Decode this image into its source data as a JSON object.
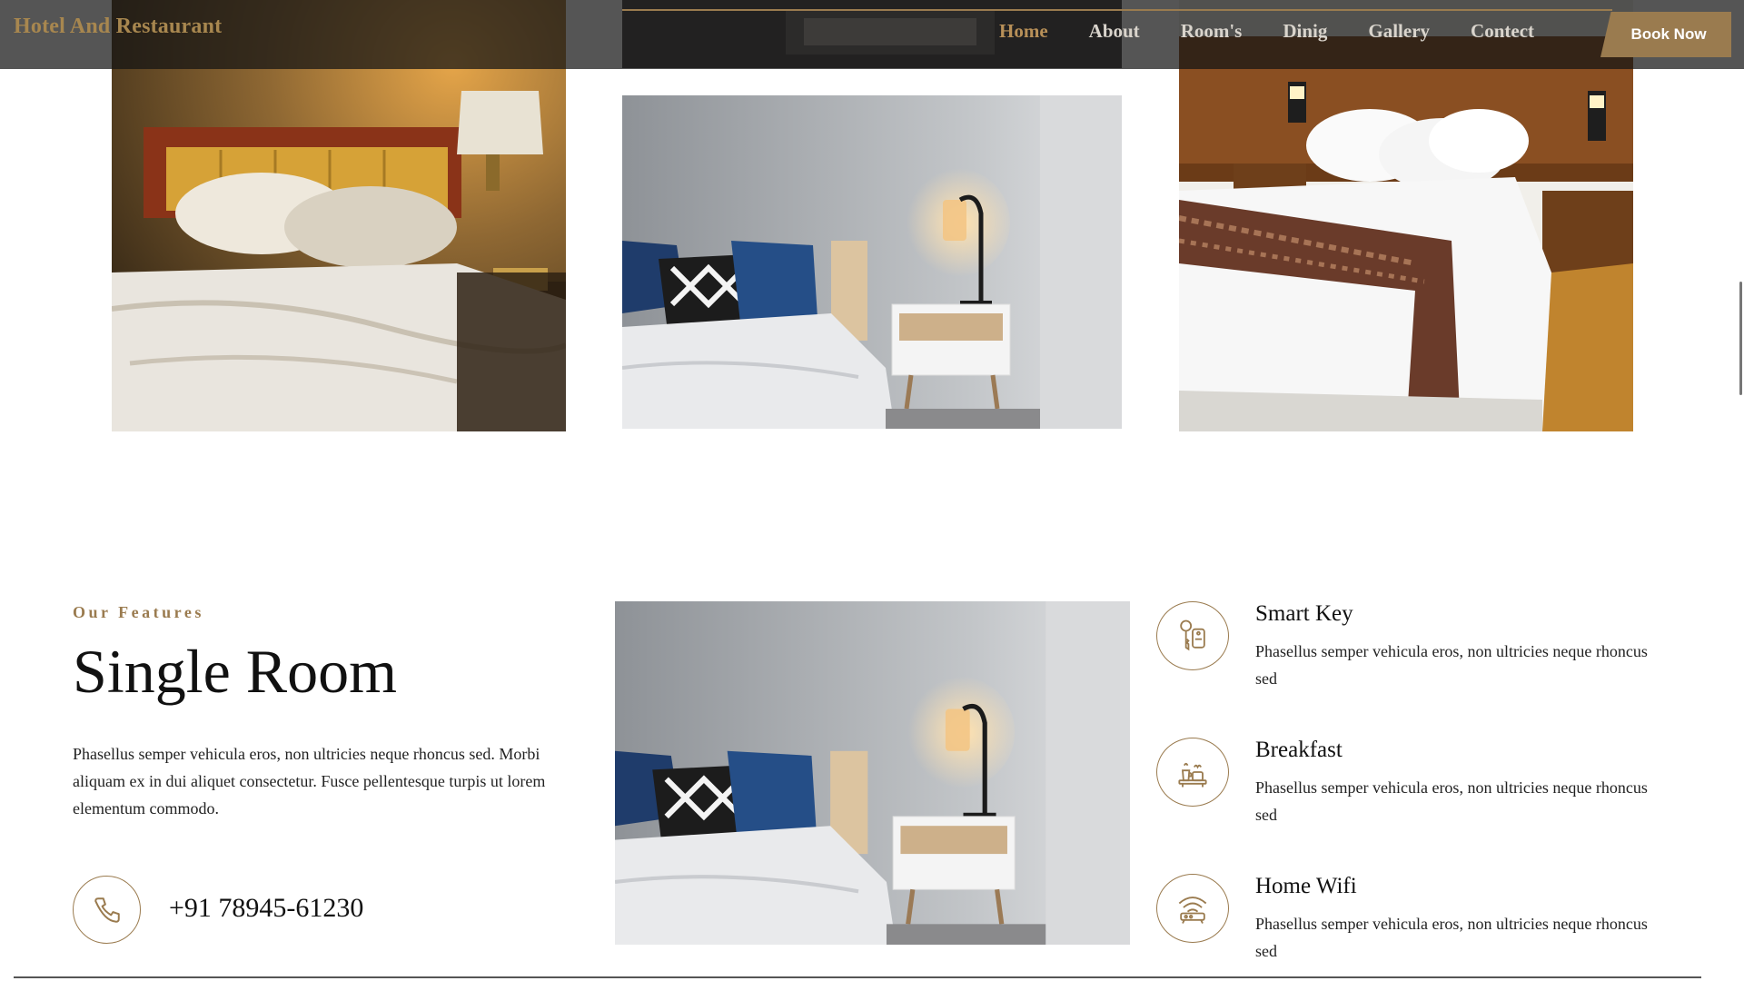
{
  "nav": {
    "brand": "Hotel And Restaurant",
    "links": [
      "Home",
      "About",
      "Room's",
      "Dinig",
      "Gallery",
      "Contect"
    ],
    "active": "Home",
    "book_label": "Book Now"
  },
  "gallery": {
    "photos": [
      "bedroom-amber-lamp-photo",
      "bedroom-grey-wall-photo",
      "bedroom-white-bed-photo"
    ]
  },
  "features": {
    "eyebrow": "Our Features",
    "title": "Single Room",
    "description": "Phasellus semper vehicula eros, non ultricies neque rhoncus sed. Morbi aliquam ex in dui aliquet consectetur. Fusce pellentesque turpis ut lorem elementum commodo.",
    "phone": "+91 78945-61230",
    "items": [
      {
        "title": "Smart Key",
        "text": "Phasellus semper vehicula eros, non ultricies neque rhoncus sed",
        "icon": "smart-key-icon"
      },
      {
        "title": "Breakfast",
        "text": "Phasellus semper vehicula eros, non ultricies neque rhoncus sed",
        "icon": "breakfast-icon"
      },
      {
        "title": "Home Wifi",
        "text": "Phasellus semper vehicula eros, non ultricies neque rhoncus sed",
        "icon": "wifi-icon"
      }
    ]
  },
  "colors": {
    "accent": "#9a7b4f",
    "nav_bg": "#141414",
    "text": "#111111"
  }
}
